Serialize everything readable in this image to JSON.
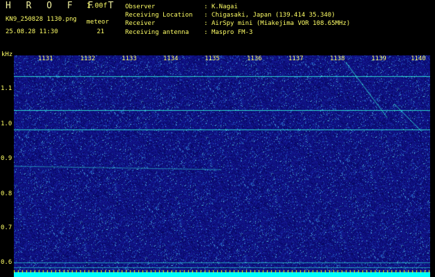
{
  "header": {
    "app_title": "H R O F F T",
    "version": "1.00f",
    "filename": "KN9_250828 1130.png",
    "meteor_label": "meteor",
    "datetime": "25.08.28 11:30",
    "meteor_count": "21"
  },
  "info": [
    {
      "key": "Observer",
      "value": ": K.Nagai"
    },
    {
      "key": "Receiving Location",
      "value": ": Chigasaki, Japan (139.414 35.340)"
    },
    {
      "key": "Receiver",
      "value": ": AirSpy mini (Miakejima VOR 108.65MHz)"
    },
    {
      "key": "Receiving antenna",
      "value": ": Maspro FM-3"
    }
  ],
  "axis": {
    "y_unit": "kHz",
    "y_ticks": [
      "1.1",
      "1.0",
      "0.9",
      "0.8",
      "0.7",
      "0.6"
    ],
    "x_ticks": [
      "1131",
      "1132",
      "1133",
      "1134",
      "1135",
      "1136",
      "1137",
      "1138",
      "1139",
      "1140"
    ]
  },
  "colors": {
    "background": "#000000",
    "text": "#ffff66",
    "spectrogram_base": "#16168c",
    "carrier_line": "#33ffe0",
    "noise_floor_band": "#00ffff",
    "tick_marks": "#ffff00"
  },
  "spectrogram": {
    "y_range_khz": [
      0.58,
      1.17
    ],
    "x_range": [
      1130.5,
      1140.3
    ],
    "horizontal_lines_khz": [
      1.115,
      1.025,
      0.972,
      0.618,
      0.605
    ]
  }
}
